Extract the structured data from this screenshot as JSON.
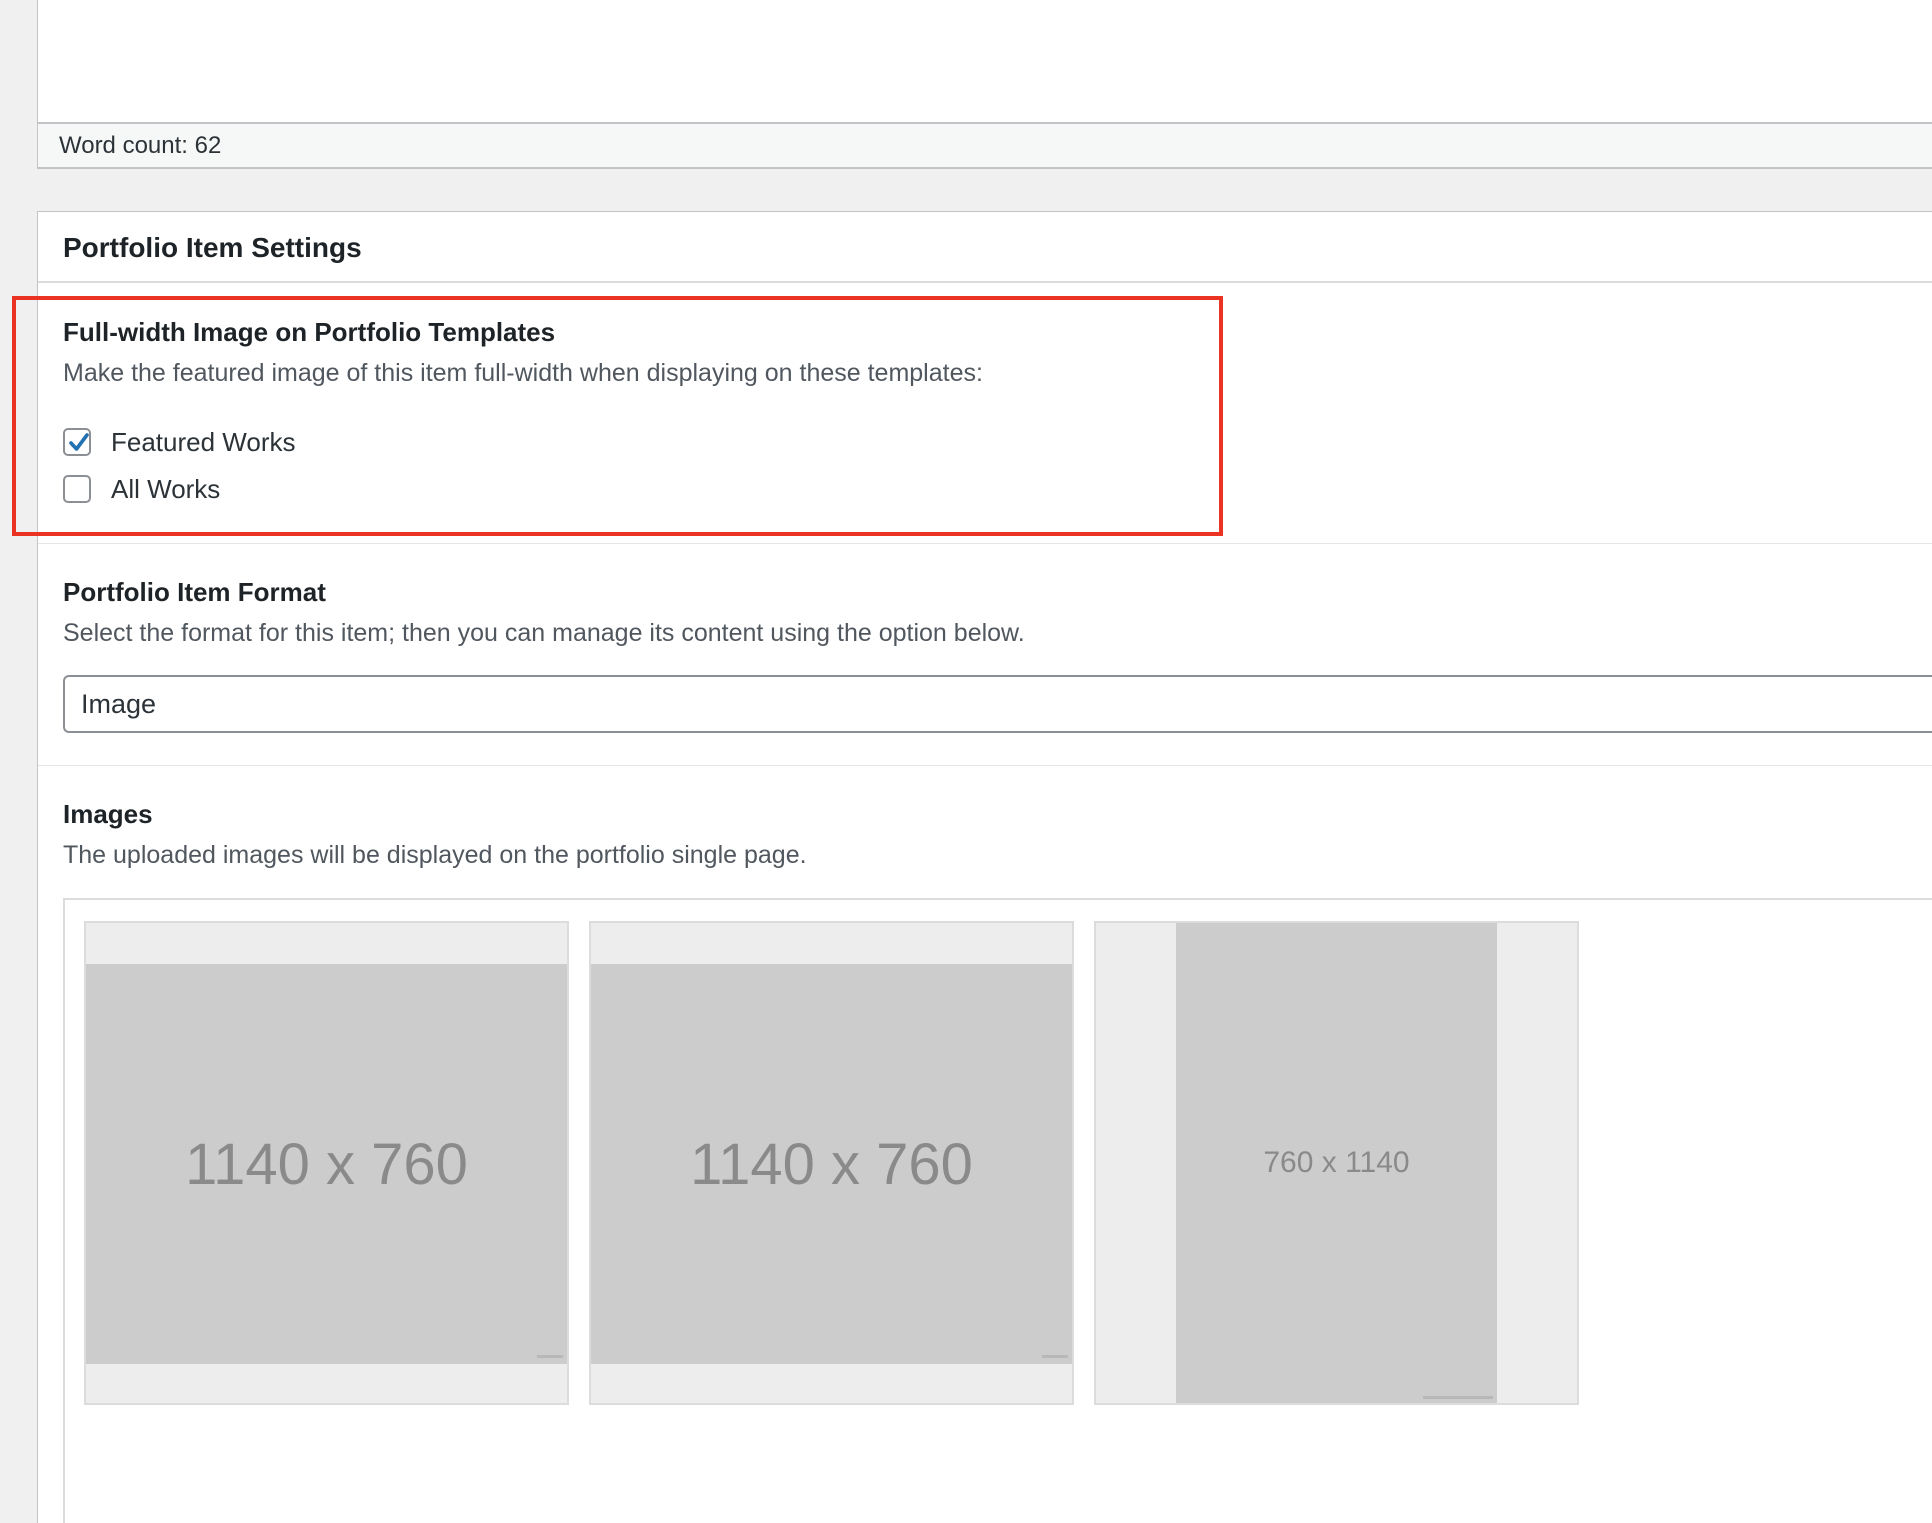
{
  "editor": {
    "word_count": "Word count: 62"
  },
  "settings": {
    "title": "Portfolio Item Settings",
    "full_width": {
      "title": "Full-width Image on Portfolio Templates",
      "description": "Make the featured image of this item full-width when displaying on these templates:",
      "options": [
        {
          "label": "Featured Works",
          "checked": true
        },
        {
          "label": "All Works",
          "checked": false
        }
      ]
    },
    "format": {
      "title": "Portfolio Item Format",
      "description": "Select the format for this item; then you can manage its content using the option below.",
      "selected": "Image"
    },
    "images": {
      "title": "Images",
      "description": "The uploaded images will be displayed on the portfolio single page.",
      "items": [
        {
          "label": "1140 x 760"
        },
        {
          "label": "1140 x 760"
        },
        {
          "label": "760 x 1140"
        }
      ]
    }
  },
  "colors": {
    "highlight": "#ea3323",
    "checkbox_check": "#2271b1",
    "placeholder": "#cccccc"
  }
}
